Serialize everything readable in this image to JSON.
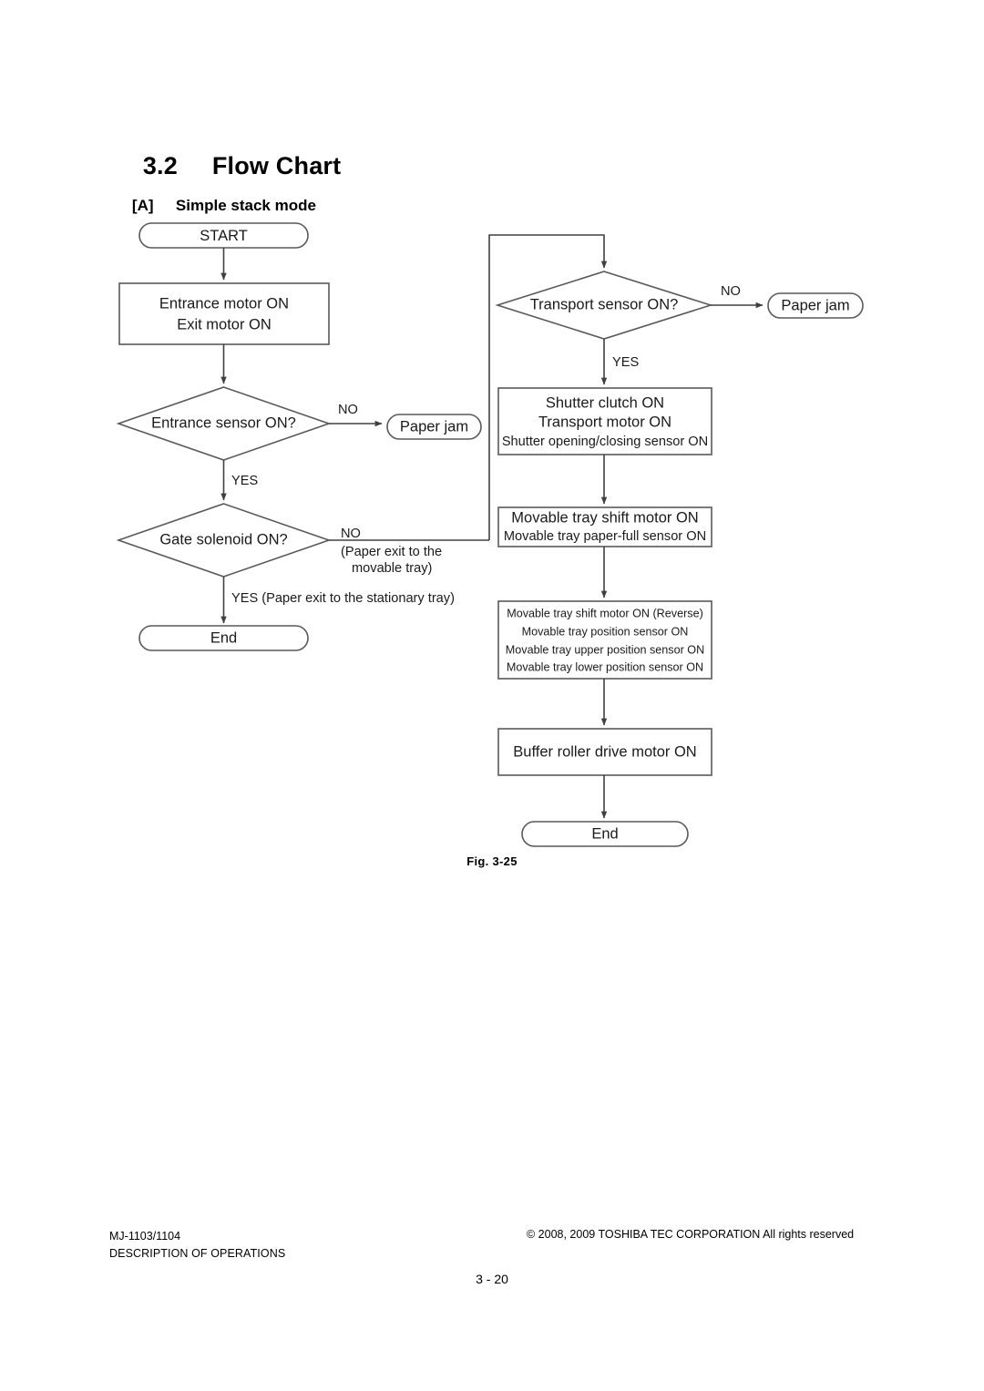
{
  "document": {
    "section_number": "3.2",
    "section_title": "Flow Chart",
    "subsection_tag": "[A]",
    "subsection_title": "Simple stack mode",
    "figure_caption": "Fig. 3-25"
  },
  "footer": {
    "model": "MJ-1103/1104",
    "chapter": "DESCRIPTION OF OPERATIONS",
    "copyright": "© 2008, 2009 TOSHIBA TEC CORPORATION All rights reserved",
    "page_number": "3 - 20"
  },
  "chart_data": {
    "type": "diagram",
    "title": "Simple stack mode flow chart",
    "nodes": {
      "start": {
        "shape": "oval",
        "label": "START"
      },
      "motors_on": {
        "shape": "rect",
        "line1": "Entrance motor ON",
        "line2": "Exit motor ON"
      },
      "entrance_sensor": {
        "shape": "diamond",
        "label": "Entrance sensor ON?"
      },
      "paper_jam_left": {
        "shape": "oval",
        "label": "Paper jam"
      },
      "gate_solenoid": {
        "shape": "diamond",
        "label": "Gate solenoid ON?"
      },
      "end_left": {
        "shape": "oval",
        "label": "End"
      },
      "transport_sensor": {
        "shape": "diamond",
        "label": "Transport sensor ON?"
      },
      "paper_jam_right": {
        "shape": "oval",
        "label": "Paper jam"
      },
      "shutter": {
        "shape": "rect",
        "line1": "Shutter clutch ON",
        "line2": "Transport motor ON",
        "line3": "Shutter opening/closing sensor ON"
      },
      "tray_shift": {
        "shape": "rect",
        "line1": "Movable tray shift motor ON",
        "line2": "Movable tray paper-full sensor ON"
      },
      "tray_reverse": {
        "shape": "rect",
        "line1": "Movable tray shift motor ON (Reverse)",
        "line2": "Movable tray position sensor  ON",
        "line3": "Movable tray upper position sensor  ON",
        "line4": "Movable tray lower position sensor ON"
      },
      "buffer_roller": {
        "shape": "rect",
        "label": "Buffer roller drive motor ON"
      },
      "end_right": {
        "shape": "oval",
        "label": "End"
      }
    },
    "edge_labels": {
      "entrance_no": "NO",
      "entrance_yes": "YES",
      "gate_no": "NO",
      "gate_no_note1": "(Paper exit to the",
      "gate_no_note2": "movable tray)",
      "gate_yes": "YES (Paper exit to the stationary tray)",
      "transport_no": "NO",
      "transport_yes": "YES"
    }
  }
}
